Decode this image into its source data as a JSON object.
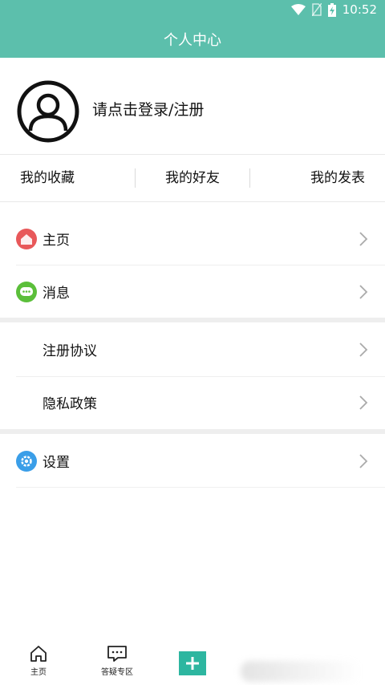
{
  "status_bar": {
    "time": "10:52",
    "icons": [
      "wifi-icon",
      "no-sim-icon",
      "battery-charging-icon"
    ]
  },
  "header": {
    "title": "个人中心"
  },
  "profile": {
    "avatar_icon": "user-avatar-icon",
    "login_text": "请点击登录/注册"
  },
  "quick_links": [
    {
      "label": "我的收藏"
    },
    {
      "label": "我的好友"
    },
    {
      "label": "我的发表"
    }
  ],
  "menu": {
    "section1": [
      {
        "label": "主页",
        "icon": "home-icon",
        "icon_color": "#e8585a"
      },
      {
        "label": "消息",
        "icon": "message-icon",
        "icon_color": "#5bbf3a"
      }
    ],
    "section2": [
      {
        "label": "注册协议"
      },
      {
        "label": "隐私政策"
      }
    ],
    "section3": [
      {
        "label": "设置",
        "icon": "settings-icon",
        "icon_color": "#3a9ee8"
      }
    ]
  },
  "tab_bar": {
    "tabs": [
      {
        "label": "主页",
        "icon": "home-outline-icon"
      },
      {
        "label": "答疑专区",
        "icon": "chat-outline-icon"
      },
      {
        "label": "",
        "icon": "plus-icon"
      }
    ],
    "accent": "#2db6a0"
  },
  "colors": {
    "primary": "#5cbfac"
  }
}
